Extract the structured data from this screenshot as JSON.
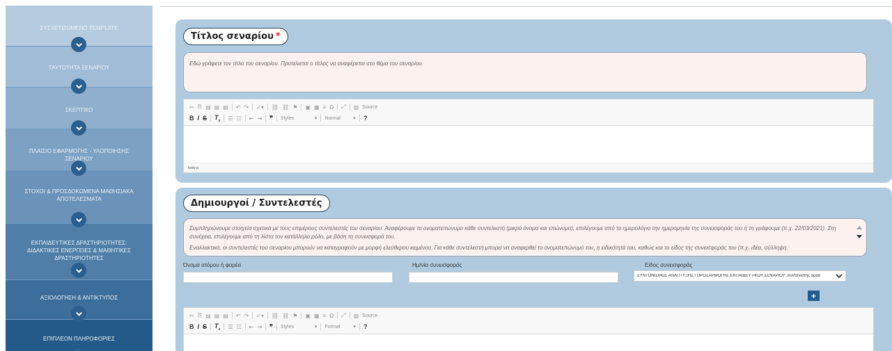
{
  "sidebar": {
    "items": [
      {
        "label": "ΣΥΣΧΕΤΙΖΟΜΕΝΟ TEMPLATE",
        "bg": "#b5cbe0"
      },
      {
        "label": "ΤΑΥΤΟΤΗΤΑ ΣΕΝΑΡΙΟΥ",
        "bg": "#a1bcd6"
      },
      {
        "label": "ΣΚΕΠΤΙΚΟ",
        "bg": "#8fafcc"
      },
      {
        "label": "ΠΛΑΙΣΙΟ ΕΦΑΡΜΟΓΗΣ - ΥΛΟΠΟΙΗΣΗΣ ΣΕΝΑΡΙΟΥ",
        "bg": "#7da1c3"
      },
      {
        "label": "ΣΤΟΧΟΙ & ΠΡΟΣΔΟΚΩΜΕΝΑ ΜΑΘΗΣΙΑΚΑ ΑΠΟΤΕΛΕΣΜΑΤΑ",
        "bg": "#6b92b8"
      },
      {
        "label": "ΕΚΠΑΙΔΕΥΤΙΚΕΣ ΔΡΑΣΤΗΡΙΟΤΗΤΕΣ: ΔΙΔΑΚΤΙΚΕΣ ΕΝΕΡΓΕΙΕΣ & ΜΑΘΗΤΙΚΕΣ ΔΡΑΣΤΗΡΙΟΤΗΤΕΣ",
        "bg": "#4f7ea8"
      },
      {
        "label": "ΑΞΙΟΛΟΓΗΣΗ & ΑΝΤΙΚΤΥΠΟΣ",
        "bg": "#3c6e9b"
      },
      {
        "label": "ΕΠΙΠΛΕΟΝ ΠΛΗΡΟΦΟΡΙΕΣ",
        "bg": "#245a8a"
      }
    ]
  },
  "title_section": {
    "heading": "Τίτλος σεναρίου",
    "required_mark": "*",
    "hint": "Εδώ γράφετε τον τίτλο του σεναρίου. Προτείνεται ο τίτλος να αναφέρεται στο θέμα του σεναρίου.",
    "editor_status": "body  p"
  },
  "toolbar": {
    "source_label": "Source",
    "styles_label": "Styles",
    "normal_label": "Normal",
    "format_label": "Format",
    "help_label": "?"
  },
  "creators_section": {
    "heading": "Δημιουργοί / Συντελεστές",
    "hint_line1": "Συμπληρώνουμε στοιχεία σχετικά με τους επιμέρους συντελεστές του σεναρίου. Αναφέρουμε το ονοματεπώνυμο κάθε συντελεστή (μικρό όνομα και επώνυμο), επιλέγουμε από το ημερολόγιο την ημερομηνία της συνεισφοράς του ή τη γράφουμε (π.χ. 22/03/2021). Στη συνέχεια, επιλέγουμε από τη λίστα τον κατάλληλο ρόλο, με βάση τη συνεισφορά του.",
    "hint_line2": "Εναλλακτικά, οι συντελεστές του σεναρίου μπορούν να καταγραφούν με μορφή ελεύθερου κειμένου. Για κάθε συντελεστή μπορεί να αναφερθεί το ονοματεπώνυμό του, η ειδικότητά του, καθώς και το είδος της συνεισφοράς του (π.χ. ιδέα, σύλληψη,",
    "name_label": "Όνομα ατόμου ή φορέα",
    "date_label": "Ημ/νία συνεισφοράς",
    "type_label": "Είδος συνεισφοράς",
    "type_value": "ΣΥΝΤΟΝΙΣΜΟΣ ΑΝΑΠΤΥΞΗΣ / ΠΡΟΣΑΡΜΟΓΗΣ ΕΚΠΑΙΔΕΥΤΙΚΟΥ ΣΕΝΑΡΙΟΥ::συντονιστής ομάδ",
    "add_label": "+"
  },
  "colors": {
    "panel_bg": "#b0cbe0",
    "accent": "#215d93",
    "required": "#e11d1d"
  }
}
